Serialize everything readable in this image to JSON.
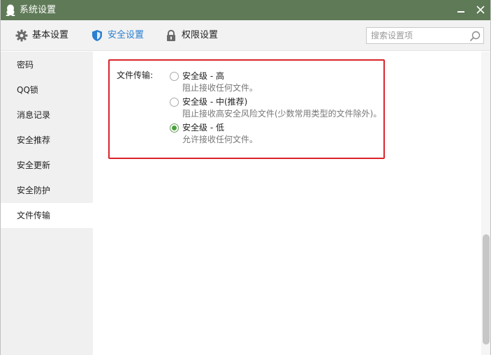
{
  "window": {
    "title": "系统设置"
  },
  "toolbar": {
    "basic_label": "基本设置",
    "security_label": "安全设置",
    "permission_label": "权限设置",
    "active_color": "#2a7fd0"
  },
  "search": {
    "placeholder": "搜索设置项"
  },
  "sidebar": {
    "items": [
      {
        "label": "密码"
      },
      {
        "label": "QQ锁"
      },
      {
        "label": "消息记录"
      },
      {
        "label": "安全推荐"
      },
      {
        "label": "安全更新"
      },
      {
        "label": "安全防护"
      },
      {
        "label": "文件传输",
        "active": true
      }
    ]
  },
  "file_transfer": {
    "label": "文件传输:",
    "options": [
      {
        "title": "安全级 - 高",
        "desc": "阻止接收任何文件。",
        "selected": false
      },
      {
        "title": "安全级 - 中(推荐)",
        "desc": "阻止接收高安全风险文件(少数常用类型的文件除外)。",
        "selected": false
      },
      {
        "title": "安全级 - 低",
        "desc": "允许接收任何文件。",
        "selected": true
      }
    ],
    "highlight_color": "#d9232a"
  },
  "colors": {
    "titlebar": "#5f7a57",
    "radio_checked": "#4aa03d"
  }
}
